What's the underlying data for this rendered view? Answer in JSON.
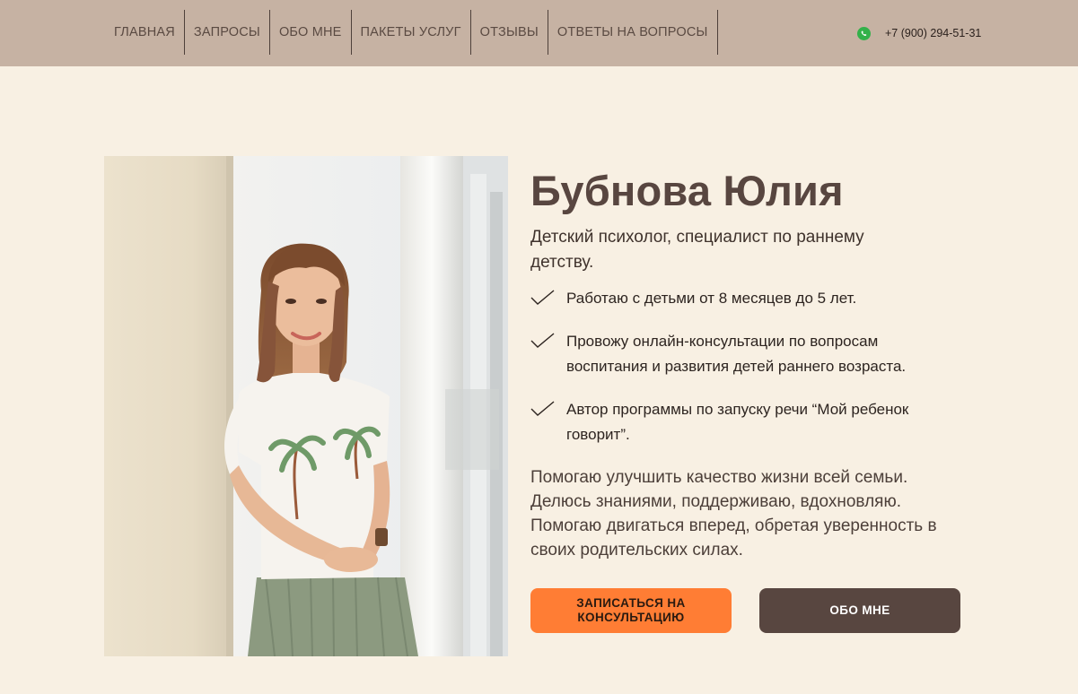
{
  "nav": {
    "items": [
      {
        "label": "ГЛАВНАЯ"
      },
      {
        "label": "ЗАПРОСЫ"
      },
      {
        "label": "ОБО МНЕ"
      },
      {
        "label": "ПАКЕТЫ УСЛУГ"
      },
      {
        "label": "ОТЗЫВЫ"
      },
      {
        "label": "ОТВЕТЫ НА ВОПРОСЫ"
      }
    ],
    "phone": "+7 (900) 294-51-31",
    "phone_icon": "whatsapp-icon"
  },
  "hero": {
    "title": "Бубнова Юлия",
    "subtitle": "Детский психолог, специалист по раннему детству.",
    "bullets": [
      {
        "text": "Работаю с детьми от 8 месяцев до 5 лет."
      },
      {
        "text": "Провожу онлайн-консультации по вопросам воспитания и развития детей раннего возраста."
      },
      {
        "text": "Автор программы по запуску речи “Мой ребенок говорит”."
      }
    ],
    "description": "Помогаю улучшить качество жизни всей семьи. Делюсь знаниями, поддерживаю, вдохновляю. Помогаю двигаться вперед, обретая уверенность в своих родительских силах.",
    "primary_button": "ЗАПИСАТЬСЯ НА КОНСУЛЬТАЦИЮ",
    "secondary_button": "ОБО МНЕ"
  },
  "colors": {
    "header_bg": "#c6b2a3",
    "page_bg": "#f8f0e3",
    "accent_orange": "#ff7d34",
    "accent_brown": "#584640",
    "whatsapp_green": "#33b14a"
  }
}
